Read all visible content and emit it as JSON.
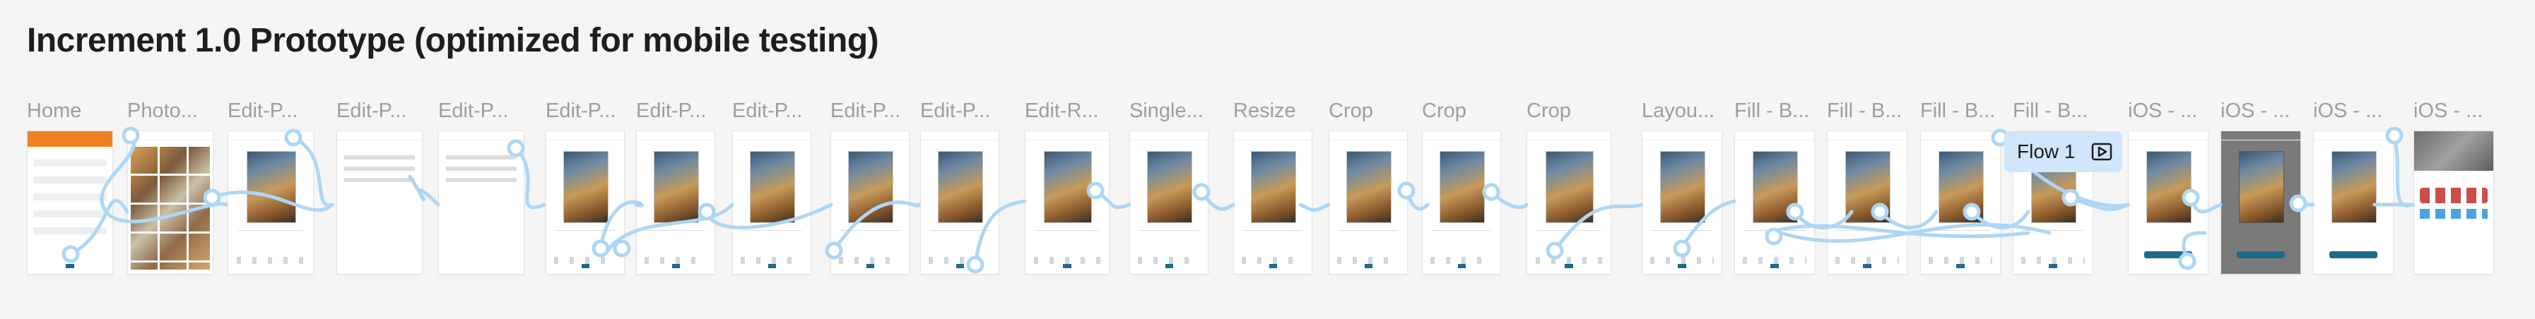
{
  "title": "Increment 1.0 Prototype (optimized for mobile testing)",
  "flow": {
    "label": "Flow 1",
    "icon": "play-icon"
  },
  "frames": [
    {
      "label": "Home",
      "kind": "home"
    },
    {
      "label": "Photo...",
      "kind": "grid"
    },
    {
      "label": "Edit-P...",
      "kind": "edit"
    },
    {
      "label": "Edit-P...",
      "kind": "list-only"
    },
    {
      "label": "Edit-P...",
      "kind": "list-only"
    },
    {
      "label": "Edit-P...",
      "kind": "edit"
    },
    {
      "label": "Edit-P...",
      "kind": "edit"
    },
    {
      "label": "Edit-P...",
      "kind": "edit"
    },
    {
      "label": "Edit-P...",
      "kind": "edit"
    },
    {
      "label": "Edit-P...",
      "kind": "edit"
    },
    {
      "label": "Edit-R...",
      "kind": "edit"
    },
    {
      "label": "Single...",
      "kind": "edit"
    },
    {
      "label": "Resize",
      "kind": "edit"
    },
    {
      "label": "Crop",
      "kind": "edit"
    },
    {
      "label": "Crop",
      "kind": "edit"
    },
    {
      "label": "Crop",
      "kind": "edit"
    },
    {
      "label": "Layou...",
      "kind": "edit"
    },
    {
      "label": "Fill - B...",
      "kind": "edit"
    },
    {
      "label": "Fill - B...",
      "kind": "edit"
    },
    {
      "label": "Fill - B...",
      "kind": "edit"
    },
    {
      "label": "Fill - B...",
      "kind": "edit"
    },
    {
      "label": "iOS - ...",
      "kind": "edit"
    },
    {
      "label": "iOS - ...",
      "kind": "grey"
    },
    {
      "label": "iOS - ...",
      "kind": "edit"
    },
    {
      "label": "iOS - ...",
      "kind": "share"
    }
  ],
  "colors": {
    "wire": "#aed6f5",
    "accent": "#1f6a8a",
    "home_header": "#f0811e",
    "flow_badge": "#cfe6fb"
  }
}
